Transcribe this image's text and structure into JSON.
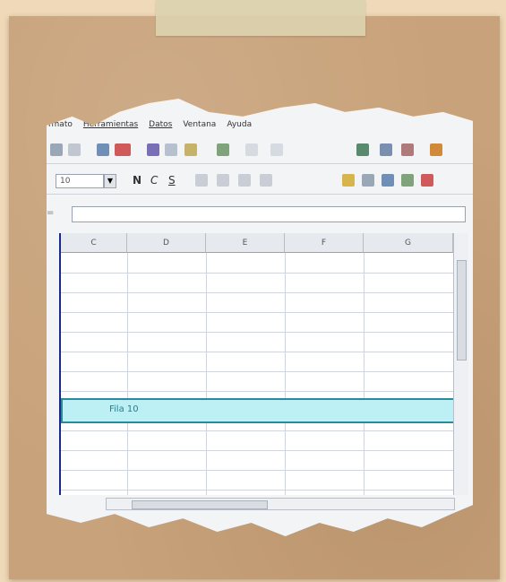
{
  "menubar": {
    "items": [
      "rmato",
      "Herramientas",
      "Datos",
      "Ventana",
      "Ayuda"
    ]
  },
  "toolbar2": {
    "font_size_value": "10",
    "bold_label": "N",
    "italic_label": "C",
    "underline_label": "S"
  },
  "formulabar": {
    "name_label": "=",
    "value": ""
  },
  "sheet": {
    "columns": [
      "C",
      "D",
      "E",
      "F",
      "G"
    ],
    "highlighted_cell_text": "Fila 10"
  },
  "colors": {
    "highlight_fill": "#bdf0f4",
    "highlight_border": "#2a8a9a",
    "background_cardboard": "#c8a27a"
  }
}
